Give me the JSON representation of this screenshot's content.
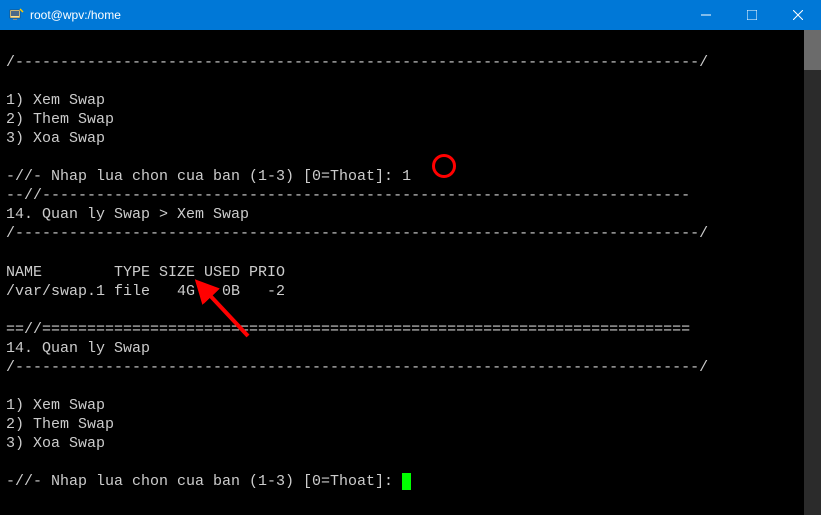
{
  "window": {
    "title": "root@wpv:/home"
  },
  "terminal": {
    "divider1": "/----------------------------------------------------------------------------/",
    "menu1_item1": "1) Xem Swap",
    "menu1_item2": "2) Them Swap",
    "menu1_item3": "3) Xoa Swap",
    "prompt1_prefix": "-//- Nhap lua chon cua ban (1-3) [0=Thoat]: ",
    "prompt1_input": "1",
    "divider2": "--//------------------------------------------------------------------------",
    "breadcrumb": "14. Quan ly Swap > Xem Swap",
    "divider3": "/----------------------------------------------------------------------------/",
    "swap_header": "NAME        TYPE SIZE USED PRIO",
    "swap_row": "/var/swap.1 file   4G   0B   -2",
    "divider4": "==//========================================================================",
    "section_title": "14. Quan ly Swap",
    "divider5": "/----------------------------------------------------------------------------/",
    "menu2_item1": "1) Xem Swap",
    "menu2_item2": "2) Them Swap",
    "menu2_item3": "3) Xoa Swap",
    "prompt2": "-//- Nhap lua chon cua ban (1-3) [0=Thoat]: "
  }
}
